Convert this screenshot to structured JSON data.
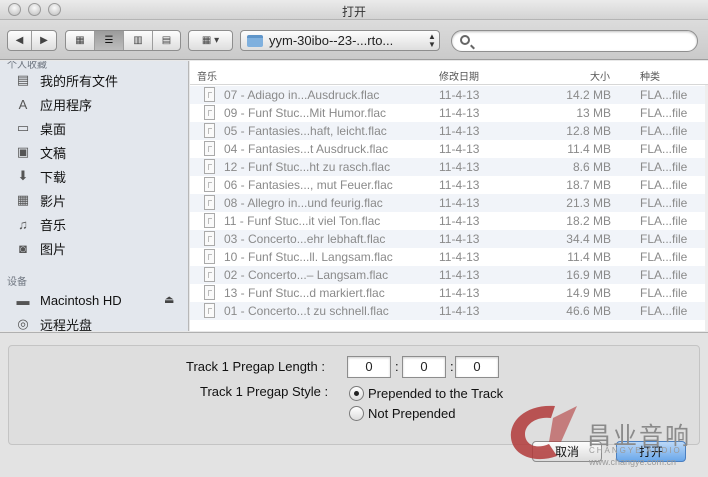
{
  "window": {
    "title": "打开"
  },
  "toolbar": {
    "back_label": "◀",
    "forward_label": "▶",
    "view_icon_label": "▦",
    "view_list_label": "☰",
    "view_column_label": "▥",
    "view_coverflow_label": "▤",
    "arrange_label": "▦ ▾",
    "path": "yym-30ibo--23-...rto...",
    "search_placeholder": "",
    "search_value": ""
  },
  "sidebar": {
    "section_favorites": "个人收藏",
    "favorites": [
      {
        "label": "我的所有文件",
        "icon": "all-files-icon",
        "glyph": "▤"
      },
      {
        "label": "应用程序",
        "icon": "applications-icon",
        "glyph": "A"
      },
      {
        "label": "桌面",
        "icon": "desktop-icon",
        "glyph": "▭"
      },
      {
        "label": "文稿",
        "icon": "documents-icon",
        "glyph": "▣"
      },
      {
        "label": "下载",
        "icon": "downloads-icon",
        "glyph": "⬇"
      },
      {
        "label": "影片",
        "icon": "movies-icon",
        "glyph": "▦"
      },
      {
        "label": "音乐",
        "icon": "music-icon",
        "glyph": "♫"
      },
      {
        "label": "图片",
        "icon": "pictures-icon",
        "glyph": "◙"
      }
    ],
    "section_devices": "设备",
    "devices": [
      {
        "label": "Macintosh HD",
        "icon": "hard-drive-icon",
        "glyph": "▬",
        "eject": "⏏"
      },
      {
        "label": "远程光盘",
        "icon": "remote-disc-icon",
        "glyph": "◎"
      }
    ]
  },
  "file_list": {
    "columns": {
      "name": "音乐",
      "modified": "修改日期",
      "size": "大小",
      "kind": "种类"
    },
    "rows": [
      {
        "name": "07 - Adiago in...Ausdruck.flac",
        "modified": "11-4-13",
        "size": "14.2 MB",
        "kind": "FLA...file"
      },
      {
        "name": "09 - Funf Stuc...Mit Humor.flac",
        "modified": "11-4-13",
        "size": "13 MB",
        "kind": "FLA...file"
      },
      {
        "name": "05 - Fantasies...haft, leicht.flac",
        "modified": "11-4-13",
        "size": "12.8 MB",
        "kind": "FLA...file"
      },
      {
        "name": "04 - Fantasies...t Ausdruck.flac",
        "modified": "11-4-13",
        "size": "11.4 MB",
        "kind": "FLA...file"
      },
      {
        "name": "12 - Funf Stuc...ht zu rasch.flac",
        "modified": "11-4-13",
        "size": "8.6 MB",
        "kind": "FLA...file"
      },
      {
        "name": "06 - Fantasies..., mut Feuer.flac",
        "modified": "11-4-13",
        "size": "18.7 MB",
        "kind": "FLA...file"
      },
      {
        "name": "08 - Allegro in...und feurig.flac",
        "modified": "11-4-13",
        "size": "21.3 MB",
        "kind": "FLA...file"
      },
      {
        "name": "11 - Funf Stuc...it viel Ton.flac",
        "modified": "11-4-13",
        "size": "18.2 MB",
        "kind": "FLA...file"
      },
      {
        "name": "03 - Concerto...ehr lebhaft.flac",
        "modified": "11-4-13",
        "size": "34.4 MB",
        "kind": "FLA...file"
      },
      {
        "name": "10 - Funf Stuc...ll. Langsam.flac",
        "modified": "11-4-13",
        "size": "11.4 MB",
        "kind": "FLA...file"
      },
      {
        "name": "02 - Concerto...– Langsam.flac",
        "modified": "11-4-13",
        "size": "16.9 MB",
        "kind": "FLA...file"
      },
      {
        "name": "13 - Funf Stuc...d markiert.flac",
        "modified": "11-4-13",
        "size": "14.9 MB",
        "kind": "FLA...file"
      },
      {
        "name": "01 - Concerto...t zu schnell.flac",
        "modified": "11-4-13",
        "size": "46.6 MB",
        "kind": "FLA...file"
      }
    ]
  },
  "accessory": {
    "pregap_length_label": "Track 1 Pregap Length :",
    "pregap_values": [
      "0",
      "0",
      "0"
    ],
    "colon": ":",
    "pregap_style_label": "Track 1 Pregap Style :",
    "options": [
      {
        "label": "Prepended to the Track",
        "selected": true
      },
      {
        "label": "Not Prepended",
        "selected": false
      }
    ]
  },
  "buttons": {
    "cancel": "取消",
    "open": "打开"
  },
  "watermark": {
    "title": "昌业音响",
    "subtitle": "CHANGYE AUDIO",
    "url": "www.changye.com.cn",
    "colors": {
      "mark": "#b23a3a",
      "text": "#8a8a8a"
    }
  }
}
